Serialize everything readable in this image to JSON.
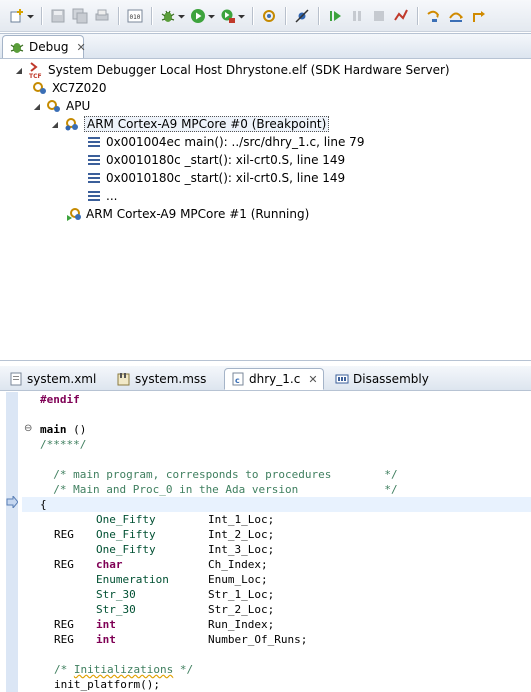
{
  "toolbar": {
    "icons": [
      "new-wizard-icon",
      "save-icon",
      "save-all-icon",
      "print-icon",
      "binary-icon",
      "debug-icon",
      "run-icon",
      "external-tools-icon",
      "target-icon",
      "skip-breakpoints-icon",
      "resume-icon",
      "suspend-icon",
      "terminate-icon",
      "disconnect-icon",
      "step-into-icon",
      "step-over-icon",
      "step-return-icon"
    ]
  },
  "debug_view": {
    "tab_label": "Debug",
    "tree": [
      {
        "label": "System Debugger Local Host Dhrystone.elf (SDK Hardware Server)",
        "icon": "tcf-launch-icon"
      },
      {
        "label": "XC7Z020",
        "icon": "device-icon"
      },
      {
        "label": "APU",
        "icon": "processor-group-icon"
      },
      {
        "label": "ARM Cortex-A9 MPCore #0 (Breakpoint)",
        "icon": "suspended-core-icon"
      },
      {
        "label": "0x001004ec main(): ../src/dhry_1.c, line 79",
        "icon": "stack-frame-icon"
      },
      {
        "label": "0x0010180c _start(): xil-crt0.S, line 149",
        "icon": "stack-frame-icon"
      },
      {
        "label": "0x0010180c _start(): xil-crt0.S, line 149",
        "icon": "stack-frame-icon"
      },
      {
        "label": "...",
        "icon": "stack-frame-icon"
      },
      {
        "label": "ARM Cortex-A9 MPCore #1 (Running)",
        "icon": "running-core-icon"
      }
    ]
  },
  "editor": {
    "tabs": [
      {
        "label": "system.xml",
        "icon": "xml-file-icon",
        "active": false
      },
      {
        "label": "system.mss",
        "icon": "mss-file-icon",
        "active": false
      },
      {
        "label": "dhry_1.c",
        "icon": "c-file-icon",
        "active": true
      },
      {
        "label": "Disassembly",
        "icon": "disassembly-icon",
        "active": false
      }
    ],
    "code": {
      "l1": "#endif",
      "l2a": "main",
      "l2b": " ()",
      "l3": "/*****/",
      "l4": "  /* main program, corresponds to procedures        */",
      "l5": "  /* Main and Proc_0 in the Ada version             */",
      "l6": "{",
      "d1_type": "One_Fifty",
      "d1_name": "Int_1_Loc;",
      "d2_reg": "REG",
      "d2_type": "One_Fifty",
      "d2_name": "Int_2_Loc;",
      "d3_type": "One_Fifty",
      "d3_name": "Int_3_Loc;",
      "d4_reg": "REG",
      "d4_type": "char",
      "d4_name": "Ch_Index;",
      "d5_type": "Enumeration",
      "d5_name": "Enum_Loc;",
      "d6_type": "Str_30",
      "d6_name": "Str_1_Loc;",
      "d7_type": "Str_30",
      "d7_name": "Str_2_Loc;",
      "d8_reg": "REG",
      "d8_type": "int",
      "d8_name": "Run_Index;",
      "d9_reg": "REG",
      "d9_type": "int",
      "d9_name": "Number_Of_Runs;",
      "c1a": "/* ",
      "c1b": "Initializations",
      "c1c": " */",
      "c2": "init_platform();"
    }
  }
}
